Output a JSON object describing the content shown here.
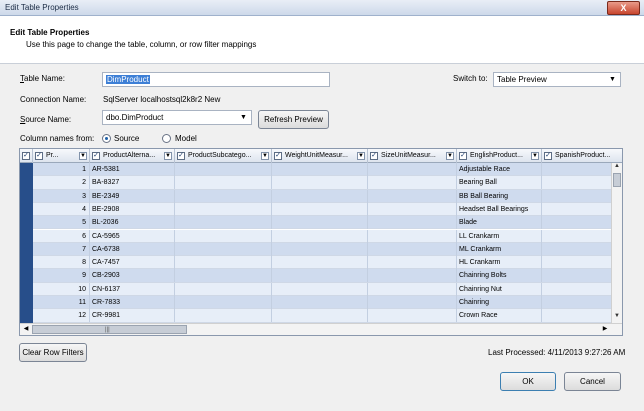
{
  "window": {
    "title": "Edit Table Properties",
    "close_glyph": "X"
  },
  "header": {
    "heading": "Edit Table Properties",
    "subheading": "Use this page to change the table, column, or row filter mappings"
  },
  "form": {
    "table_name_label_prefix": "T",
    "table_name_label_rest": "able Name:",
    "table_name_value": "DimProduct",
    "connection_name_label": "Connection Name:",
    "connection_name_value": "SqlServer localhostsql2k8r2 New",
    "source_name_label_prefix": "S",
    "source_name_label_rest": "ource Name:",
    "source_name_value": "dbo.DimProduct",
    "refresh_preview_label": "Refresh Preview",
    "column_names_from_label": "Column names from:",
    "radio_source_label": "Source",
    "radio_model_label": "Model",
    "radio_selected": "Source",
    "switch_to_label": "Switch to:",
    "switch_to_value": "Table Preview"
  },
  "grid": {
    "columns": [
      {
        "label": "Pr..."
      },
      {
        "label": "ProductAlterna..."
      },
      {
        "label": "ProductSubcatego..."
      },
      {
        "label": "WeightUnitMeasur..."
      },
      {
        "label": "SizeUnitMeasur..."
      },
      {
        "label": "EnglishProduct..."
      },
      {
        "label": "SpanishProduct..."
      }
    ],
    "rows": [
      {
        "id": "1",
        "alt": "AR-5381",
        "name": "Adjustable Race"
      },
      {
        "id": "2",
        "alt": "BA-8327",
        "name": "Bearing Ball"
      },
      {
        "id": "3",
        "alt": "BE-2349",
        "name": "BB Ball Bearing"
      },
      {
        "id": "4",
        "alt": "BE-2908",
        "name": "Headset Ball Bearings"
      },
      {
        "id": "5",
        "alt": "BL-2036",
        "name": "Blade"
      },
      {
        "id": "6",
        "alt": "CA-5965",
        "name": "LL Crankarm"
      },
      {
        "id": "7",
        "alt": "CA-6738",
        "name": "ML Crankarm"
      },
      {
        "id": "8",
        "alt": "CA-7457",
        "name": "HL Crankarm"
      },
      {
        "id": "9",
        "alt": "CB-2903",
        "name": "Chainring Bolts"
      },
      {
        "id": "10",
        "alt": "CN-6137",
        "name": "Chainring Nut"
      },
      {
        "id": "11",
        "alt": "CR-7833",
        "name": "Chainring"
      },
      {
        "id": "12",
        "alt": "CR-9981",
        "name": "Crown Race"
      }
    ],
    "scroll_grip": "|||"
  },
  "footer": {
    "clear_filters_label": "Clear Row Filters",
    "last_processed": "Last Processed: 4/11/2013 9:27:26 AM",
    "ok_label": "OK",
    "cancel_label": "Cancel"
  },
  "colors": {
    "selection": "#3d7fd6",
    "row_header": "#274e8a",
    "row_alt": "#cfdbee",
    "row": "#e7eef8"
  },
  "icons": {
    "column_checkbox": "checkbox-icon",
    "column_filter": "dropdown-arrow-icon",
    "combo_arrow": "chevron-down-icon"
  }
}
